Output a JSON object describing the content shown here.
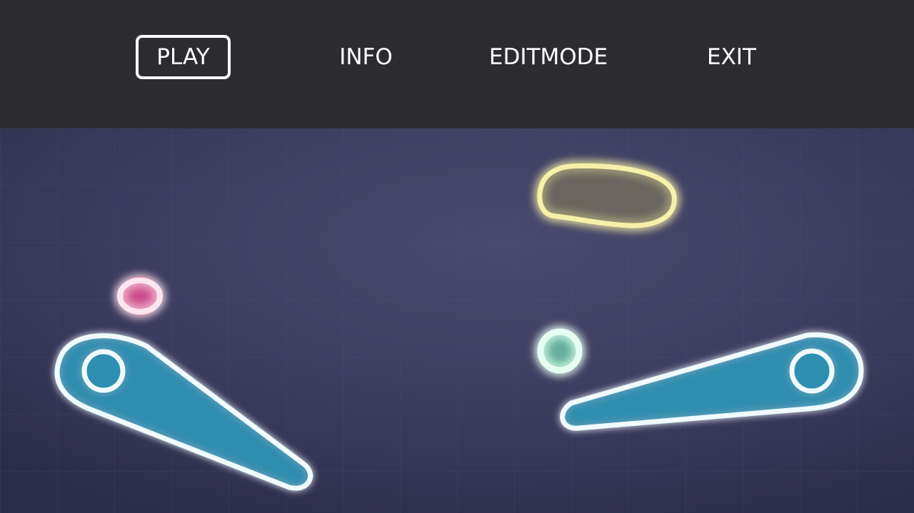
{
  "menu": {
    "items": [
      {
        "label": "PLAY",
        "selected": true
      },
      {
        "label": "INFO",
        "selected": false
      },
      {
        "label": "EDITMODE",
        "selected": false
      },
      {
        "label": "EXIT",
        "selected": false
      }
    ]
  },
  "colors": {
    "menu_bar": "#2c2b30",
    "playfield": "#3a3a5e",
    "flipper_fill": "#2f8fb0",
    "outline": "#ffffff",
    "pink_glow": "#ff4fa0",
    "green_glow": "#7fffc8",
    "yellow_glow": "#f2e27a",
    "cyan_glow": "#3fd6ff"
  },
  "icons": [
    "left-flipper-icon",
    "right-flipper-icon",
    "pink-bumper-icon",
    "green-bumper-icon",
    "yellow-capsule-target-icon"
  ]
}
